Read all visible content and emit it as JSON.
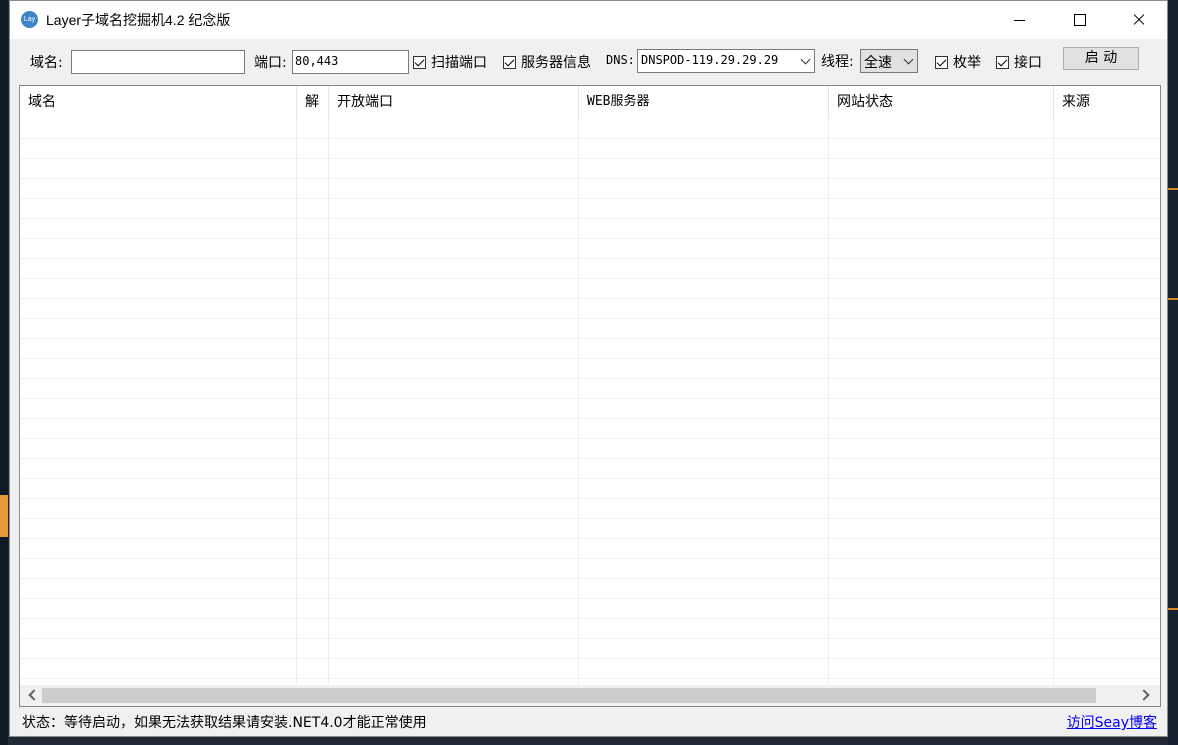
{
  "window": {
    "title": "Layer子域名挖掘机4.2 纪念版",
    "icon_text": "Lay"
  },
  "toolbar": {
    "domain_label": "域名:",
    "domain_value": "",
    "port_label": "端口:",
    "port_value": "80,443",
    "scan_ports_label": "扫描端口",
    "server_info_label": "服务器信息",
    "dns_label": "DNS:",
    "dns_value": "DNSPOD-119.29.29.29",
    "threads_label": "线程:",
    "threads_value": "全速",
    "enumerate_label": "枚举",
    "api_label": "接口",
    "start_button": "启 动"
  },
  "table": {
    "columns": [
      "域名",
      "解",
      "开放端口",
      "WEB服务器",
      "网站状态",
      "来源"
    ]
  },
  "status": {
    "text": "状态：等待启动，如果无法获取结果请安装.NET4.0才能正常使用",
    "link": "访问Seay博客"
  },
  "colors": {
    "accent": "#e59b3a",
    "link": "#0000ee"
  }
}
